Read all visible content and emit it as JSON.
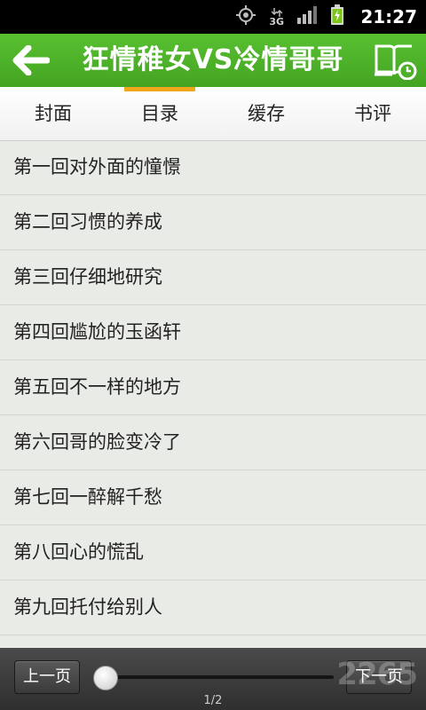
{
  "status_bar": {
    "time": "21:27",
    "network": "3G",
    "icons": [
      "gps-icon",
      "network-3g-icon",
      "signal-icon",
      "battery-icon"
    ]
  },
  "title_bar": {
    "title": "狂情稚女VS冷情哥哥",
    "back_icon": "arrow-left-icon",
    "shelf_icon": "bookshelf-history-icon"
  },
  "tabs": [
    {
      "label": "封面",
      "active": false
    },
    {
      "label": "目录",
      "active": true
    },
    {
      "label": "缓存",
      "active": false
    },
    {
      "label": "书评",
      "active": false
    }
  ],
  "chapters": [
    "第一回对外面的憧憬",
    "第二回习惯的养成",
    "第三回仔细地研究",
    "第四回尴尬的玉函轩",
    "第五回不一样的地方",
    "第六回哥的脸变冷了",
    "第七回一醉解千愁",
    "第八回心的慌乱",
    "第九回托付给别人"
  ],
  "pagination": {
    "prev_label": "上一页",
    "next_label": "下一页",
    "page_indicator": "1/2",
    "current_page": 1,
    "total_pages": 2
  },
  "watermark": "2265",
  "colors": {
    "accent_green": "#4caf2a",
    "tab_indicator": "#f0a81a"
  }
}
